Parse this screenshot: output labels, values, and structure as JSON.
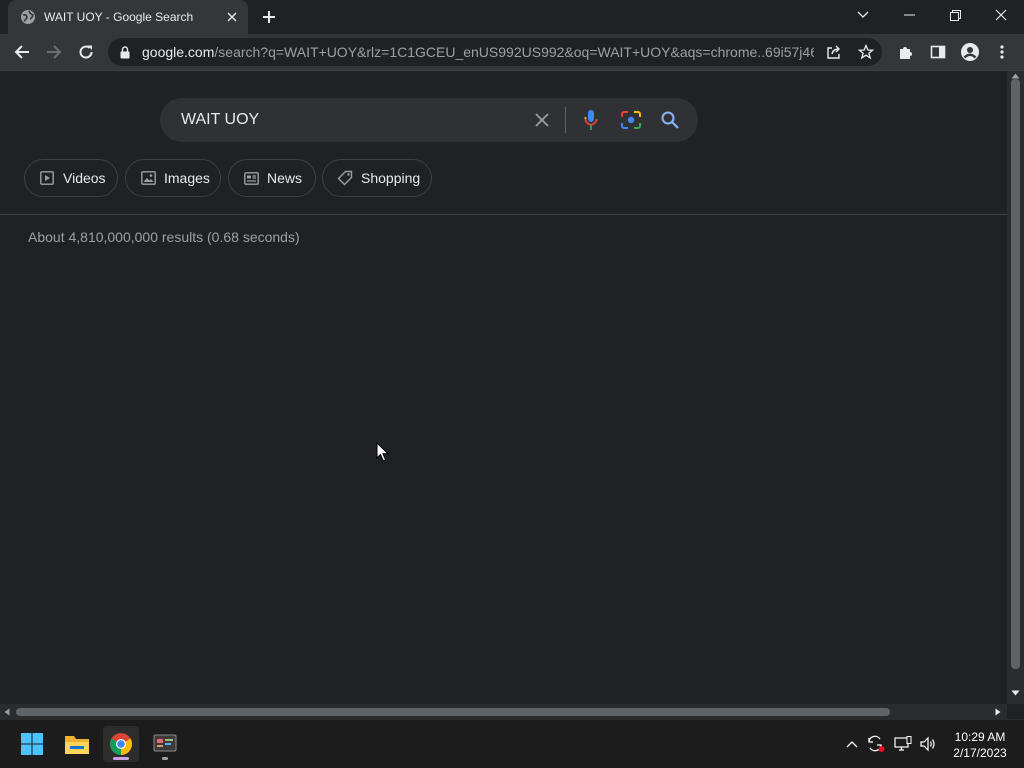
{
  "browser": {
    "tab_title": "WAIT UOY - Google Search",
    "url_host": "google.com",
    "url_path": "/search?q=WAIT+UOY&rlz=1C1GCEU_enUS992US992&oq=WAIT+UOY&aqs=chrome..69i57j46..."
  },
  "search": {
    "query": "WAIT UOY"
  },
  "filters": [
    {
      "label": "Videos"
    },
    {
      "label": "Images"
    },
    {
      "label": "News"
    },
    {
      "label": "Shopping"
    }
  ],
  "results": {
    "stats": "About 4,810,000,000 results (0.68 seconds)"
  },
  "taskbar": {
    "time": "10:29 AM",
    "date": "2/17/2023"
  },
  "colors": {
    "background": "#202124",
    "toolbar": "#35363a",
    "accent_blue": "#8ab4f8"
  }
}
